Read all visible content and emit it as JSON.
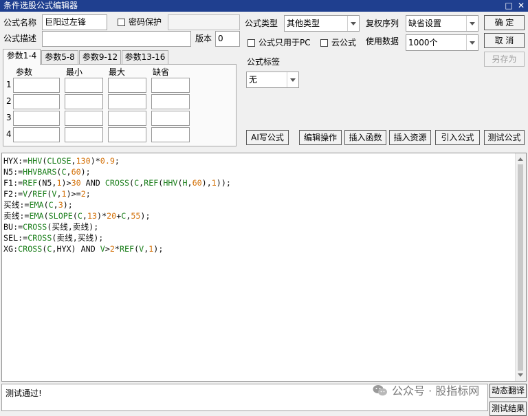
{
  "window": {
    "title": "条件选股公式编辑器"
  },
  "form": {
    "name_label": "公式名称",
    "name_value": "巨阳过左锋",
    "password_label": "密码保护",
    "password_value": "",
    "desc_label": "公式描述",
    "desc_value": "",
    "version_label": "版本",
    "version_value": "0",
    "type_label": "公式类型",
    "type_value": "其他类型",
    "pc_only_label": "公式只用于PC",
    "cloud_label": "云公式",
    "rights_label": "复权序列",
    "rights_value": "缺省设置",
    "data_label": "使用数据",
    "data_value": "1000个",
    "tag_label": "公式标签",
    "tag_value": "无"
  },
  "buttons": {
    "ok": "确  定",
    "cancel": "取  消",
    "save_as": "另存为",
    "ai": "AI写公式",
    "edit": "编辑操作",
    "insert_func": "插入函数",
    "insert_res": "插入资源",
    "import": "引入公式",
    "test": "测试公式",
    "translate": "动态翻译",
    "test_result": "测试结果"
  },
  "tabs": [
    "参数1-4",
    "参数5-8",
    "参数9-12",
    "参数13-16"
  ],
  "params": {
    "headers": [
      "参数",
      "最小",
      "最大",
      "缺省"
    ],
    "rows": [
      "1",
      "2",
      "3",
      "4"
    ]
  },
  "code": [
    [
      {
        "t": "HYX:=",
        "c": "kw"
      },
      {
        "t": "HHV",
        "c": "fn"
      },
      {
        "t": "(",
        "c": "kw"
      },
      {
        "t": "CLOSE",
        "c": "fn"
      },
      {
        "t": ",",
        "c": "kw"
      },
      {
        "t": "130",
        "c": "num"
      },
      {
        "t": ")*",
        "c": "kw"
      },
      {
        "t": "0.9",
        "c": "num"
      },
      {
        "t": ";",
        "c": "kw"
      }
    ],
    [
      {
        "t": "N5:=",
        "c": "kw"
      },
      {
        "t": "HHVBARS",
        "c": "fn"
      },
      {
        "t": "(",
        "c": "kw"
      },
      {
        "t": "C",
        "c": "fn"
      },
      {
        "t": ",",
        "c": "kw"
      },
      {
        "t": "60",
        "c": "num"
      },
      {
        "t": ");",
        "c": "kw"
      }
    ],
    [
      {
        "t": "F1:=",
        "c": "kw"
      },
      {
        "t": "REF",
        "c": "fn"
      },
      {
        "t": "(N5,",
        "c": "kw"
      },
      {
        "t": "1",
        "c": "num"
      },
      {
        "t": ")>",
        "c": "kw"
      },
      {
        "t": "30",
        "c": "num"
      },
      {
        "t": " AND ",
        "c": "kw"
      },
      {
        "t": "CROSS",
        "c": "fn"
      },
      {
        "t": "(",
        "c": "kw"
      },
      {
        "t": "C",
        "c": "fn"
      },
      {
        "t": ",",
        "c": "kw"
      },
      {
        "t": "REF",
        "c": "fn"
      },
      {
        "t": "(",
        "c": "kw"
      },
      {
        "t": "HHV",
        "c": "fn"
      },
      {
        "t": "(",
        "c": "kw"
      },
      {
        "t": "H",
        "c": "fn"
      },
      {
        "t": ",",
        "c": "kw"
      },
      {
        "t": "60",
        "c": "num"
      },
      {
        "t": "),",
        "c": "kw"
      },
      {
        "t": "1",
        "c": "num"
      },
      {
        "t": "));",
        "c": "kw"
      }
    ],
    [
      {
        "t": "F2:=",
        "c": "kw"
      },
      {
        "t": "V",
        "c": "fn"
      },
      {
        "t": "/",
        "c": "kw"
      },
      {
        "t": "REF",
        "c": "fn"
      },
      {
        "t": "(",
        "c": "kw"
      },
      {
        "t": "V",
        "c": "fn"
      },
      {
        "t": ",",
        "c": "kw"
      },
      {
        "t": "1",
        "c": "num"
      },
      {
        "t": ")>=",
        "c": "kw"
      },
      {
        "t": "2",
        "c": "num"
      },
      {
        "t": ";",
        "c": "kw"
      }
    ],
    [
      {
        "t": "买线:=",
        "c": "kw"
      },
      {
        "t": "EMA",
        "c": "fn"
      },
      {
        "t": "(",
        "c": "kw"
      },
      {
        "t": "C",
        "c": "fn"
      },
      {
        "t": ",",
        "c": "kw"
      },
      {
        "t": "3",
        "c": "num"
      },
      {
        "t": ");",
        "c": "kw"
      }
    ],
    [
      {
        "t": "卖线:=",
        "c": "kw"
      },
      {
        "t": "EMA",
        "c": "fn"
      },
      {
        "t": "(",
        "c": "kw"
      },
      {
        "t": "SLOPE",
        "c": "fn"
      },
      {
        "t": "(",
        "c": "kw"
      },
      {
        "t": "C",
        "c": "fn"
      },
      {
        "t": ",",
        "c": "kw"
      },
      {
        "t": "13",
        "c": "num"
      },
      {
        "t": ")*",
        "c": "kw"
      },
      {
        "t": "20",
        "c": "num"
      },
      {
        "t": "+",
        "c": "kw"
      },
      {
        "t": "C",
        "c": "fn"
      },
      {
        "t": ",",
        "c": "kw"
      },
      {
        "t": "55",
        "c": "num"
      },
      {
        "t": ");",
        "c": "kw"
      }
    ],
    [
      {
        "t": "BU:=",
        "c": "kw"
      },
      {
        "t": "CROSS",
        "c": "fn"
      },
      {
        "t": "(买线,卖线);",
        "c": "kw"
      }
    ],
    [
      {
        "t": "SEL:=",
        "c": "kw"
      },
      {
        "t": "CROSS",
        "c": "fn"
      },
      {
        "t": "(卖线,买线);",
        "c": "kw"
      }
    ],
    [
      {
        "t": "XG:",
        "c": "kw"
      },
      {
        "t": "CROSS",
        "c": "fn"
      },
      {
        "t": "(",
        "c": "kw"
      },
      {
        "t": "C",
        "c": "fn"
      },
      {
        "t": ",HYX) AND ",
        "c": "kw"
      },
      {
        "t": "V",
        "c": "fn"
      },
      {
        "t": ">",
        "c": "kw"
      },
      {
        "t": "2",
        "c": "num"
      },
      {
        "t": "*",
        "c": "kw"
      },
      {
        "t": "REF",
        "c": "fn"
      },
      {
        "t": "(",
        "c": "kw"
      },
      {
        "t": "V",
        "c": "fn"
      },
      {
        "t": ",",
        "c": "kw"
      },
      {
        "t": "1",
        "c": "num"
      },
      {
        "t": ");",
        "c": "kw"
      }
    ]
  ],
  "status": {
    "text": "测试通过!"
  },
  "watermark": {
    "text": "公众号 · 股指标网"
  },
  "colors": {
    "title_bar": "#1f3f8f",
    "function": "#1c7f1c",
    "number": "#d4720a"
  }
}
